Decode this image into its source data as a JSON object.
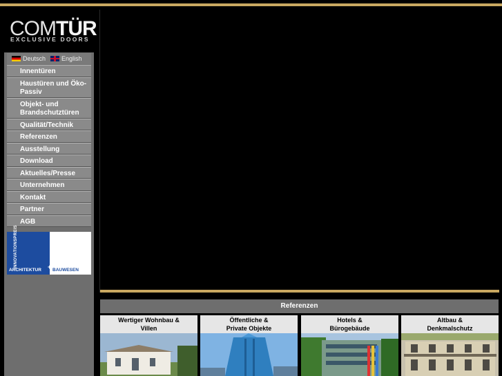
{
  "brand": {
    "logo_main": "COM",
    "logo_bold": "TÜR",
    "logo_sub": "EXCLUSIVE DOORS"
  },
  "languages": [
    {
      "label": "Deutsch",
      "icon": "flag-de-icon"
    },
    {
      "label": "English",
      "icon": "flag-gb-icon"
    }
  ],
  "menu": [
    {
      "label": "Innentüren"
    },
    {
      "label": "Haustüren und Öko-Passiv"
    },
    {
      "label": "Objekt- und Brandschutztüren"
    },
    {
      "label": "Qualität/Technik"
    },
    {
      "label": "Referenzen"
    },
    {
      "label": "Ausstellung"
    },
    {
      "label": "Download"
    },
    {
      "label": "Aktuelles/Presse"
    },
    {
      "label": "Unternehmen"
    },
    {
      "label": "Kontakt"
    },
    {
      "label": "Partner"
    },
    {
      "label": "AGB"
    }
  ],
  "banner": {
    "vertical": "INNOVATIONSPREIS",
    "left": "ARCHITEKTUR",
    "cross": "+",
    "right": "BAUWESEN"
  },
  "references": {
    "title": "Referenzen",
    "cards": [
      {
        "line1": "Wertiger Wohnbau &",
        "line2": "Villen"
      },
      {
        "line1": "Öffentliche &",
        "line2": "Private Objekte"
      },
      {
        "line1": "Hotels &",
        "line2": "Bürogebäude"
      },
      {
        "line1": "Altbau &",
        "line2": "Denkmalschutz"
      }
    ]
  },
  "colors": {
    "accent": "#c9a860",
    "sidebar": "#6e6e6e",
    "menu": "#8a8a8a",
    "banner_blue": "#1d4c9f"
  }
}
